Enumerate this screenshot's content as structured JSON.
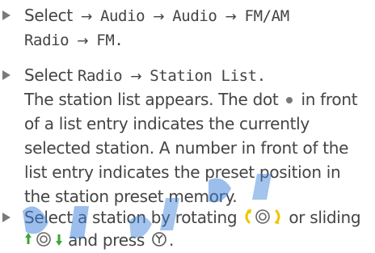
{
  "step1": {
    "select": "Select",
    "arrow": "→",
    "audio_1": "Audio",
    "audio_2": "Audio",
    "fmam": "FM/AM",
    "radio": "Radio",
    "fm": "FM."
  },
  "step2": {
    "select": "Select",
    "radio": "Radio",
    "arrow": "→",
    "station_list": "Station List.",
    "line2a": "The station list appears. The dot",
    "line2b": "in front",
    "line3": "of a list entry indicates the currently",
    "line4": "selected station. A number in front of the",
    "line5": "list entry indicates the preset position in",
    "line6": "the station preset memory."
  },
  "step3": {
    "line1a": "Select a station by rotating",
    "line1b": "or sliding",
    "line2": "and press",
    "line2_end": "."
  },
  "colors": {
    "text": "#444444",
    "bullet": "#7a7a7a",
    "controller_yellow": "#f2c400",
    "controller_green": "#3aa635",
    "watermark": "#3a7fd9"
  },
  "icons": [
    "triangle-bullet-icon",
    "selected-dot-icon",
    "rotate-controller-icon",
    "slide-controller-icon",
    "press-controller-icon"
  ]
}
